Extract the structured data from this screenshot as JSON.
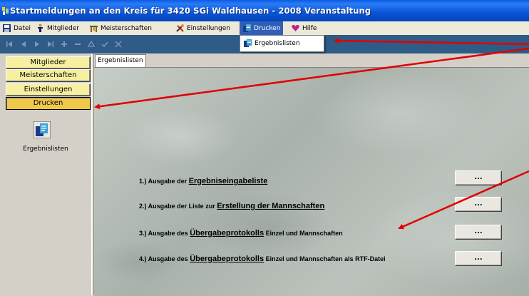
{
  "window": {
    "title": "Startmeldungen an den Kreis für 3420 SGi Waldhausen - 2008   Veranstaltung"
  },
  "menubar": {
    "items": [
      {
        "label": "Datei",
        "icon": "save-icon"
      },
      {
        "label": "Mitglieder",
        "icon": "person-icon"
      },
      {
        "label": "Meisterschaften",
        "icon": "podium-icon"
      },
      {
        "label": "Einstellungen",
        "icon": "tools-icon"
      },
      {
        "label": "Drucken",
        "icon": "print-icon"
      },
      {
        "label": "Hilfe",
        "icon": "help-icon"
      }
    ]
  },
  "dropdown": {
    "items": [
      {
        "label": "Ergebnislisten",
        "icon": "print-icon"
      }
    ]
  },
  "leftpanel": {
    "buttons": [
      "Mitglieder",
      "Meisterschaften",
      "Einstellungen",
      "Drucken"
    ],
    "selected": "Drucken",
    "icon_label": "Ergebnislisten"
  },
  "content": {
    "tab": "Ergebnislisten",
    "rows": [
      {
        "prefix": "1.) Ausgabe der ",
        "link": "Ergebniseingabeliste",
        "suffix": "",
        "button": "..."
      },
      {
        "prefix": "2.) Ausgabe der Liste zur ",
        "link": "Erstellung der Mannschaften",
        "suffix": "",
        "button": "..."
      },
      {
        "prefix": "3.) Ausgabe des ",
        "link": "Übergabeprotokolls",
        "suffix": " Einzel und Mannschaften",
        "button": "..."
      },
      {
        "prefix": "4.) Ausgabe des ",
        "link": "Übergabeprotokolls",
        "suffix": " Einzel und Mannschaften als RTF-Datei",
        "button": "..."
      }
    ]
  },
  "colors": {
    "titlebar": "#0854d6",
    "leftbutton": "#f7f0a0",
    "leftbutton_selected": "#f2c84a",
    "annotation_arrow": "#e00000"
  }
}
